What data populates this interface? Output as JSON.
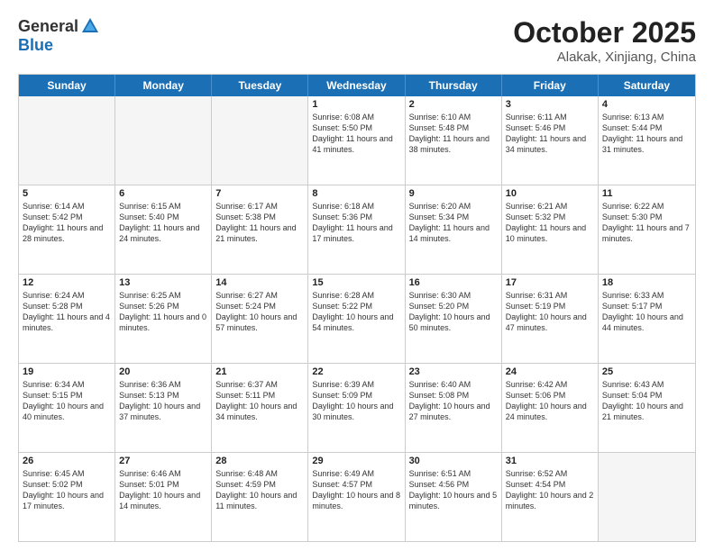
{
  "logo": {
    "general": "General",
    "blue": "Blue"
  },
  "title": "October 2025",
  "location": "Alakak, Xinjiang, China",
  "header_days": [
    "Sunday",
    "Monday",
    "Tuesday",
    "Wednesday",
    "Thursday",
    "Friday",
    "Saturday"
  ],
  "weeks": [
    [
      {
        "day": "",
        "text": "",
        "empty": true
      },
      {
        "day": "",
        "text": "",
        "empty": true
      },
      {
        "day": "",
        "text": "",
        "empty": true
      },
      {
        "day": "1",
        "text": "Sunrise: 6:08 AM\nSunset: 5:50 PM\nDaylight: 11 hours and 41 minutes."
      },
      {
        "day": "2",
        "text": "Sunrise: 6:10 AM\nSunset: 5:48 PM\nDaylight: 11 hours and 38 minutes."
      },
      {
        "day": "3",
        "text": "Sunrise: 6:11 AM\nSunset: 5:46 PM\nDaylight: 11 hours and 34 minutes."
      },
      {
        "day": "4",
        "text": "Sunrise: 6:13 AM\nSunset: 5:44 PM\nDaylight: 11 hours and 31 minutes."
      }
    ],
    [
      {
        "day": "5",
        "text": "Sunrise: 6:14 AM\nSunset: 5:42 PM\nDaylight: 11 hours and 28 minutes."
      },
      {
        "day": "6",
        "text": "Sunrise: 6:15 AM\nSunset: 5:40 PM\nDaylight: 11 hours and 24 minutes."
      },
      {
        "day": "7",
        "text": "Sunrise: 6:17 AM\nSunset: 5:38 PM\nDaylight: 11 hours and 21 minutes."
      },
      {
        "day": "8",
        "text": "Sunrise: 6:18 AM\nSunset: 5:36 PM\nDaylight: 11 hours and 17 minutes."
      },
      {
        "day": "9",
        "text": "Sunrise: 6:20 AM\nSunset: 5:34 PM\nDaylight: 11 hours and 14 minutes."
      },
      {
        "day": "10",
        "text": "Sunrise: 6:21 AM\nSunset: 5:32 PM\nDaylight: 11 hours and 10 minutes."
      },
      {
        "day": "11",
        "text": "Sunrise: 6:22 AM\nSunset: 5:30 PM\nDaylight: 11 hours and 7 minutes."
      }
    ],
    [
      {
        "day": "12",
        "text": "Sunrise: 6:24 AM\nSunset: 5:28 PM\nDaylight: 11 hours and 4 minutes."
      },
      {
        "day": "13",
        "text": "Sunrise: 6:25 AM\nSunset: 5:26 PM\nDaylight: 11 hours and 0 minutes."
      },
      {
        "day": "14",
        "text": "Sunrise: 6:27 AM\nSunset: 5:24 PM\nDaylight: 10 hours and 57 minutes."
      },
      {
        "day": "15",
        "text": "Sunrise: 6:28 AM\nSunset: 5:22 PM\nDaylight: 10 hours and 54 minutes."
      },
      {
        "day": "16",
        "text": "Sunrise: 6:30 AM\nSunset: 5:20 PM\nDaylight: 10 hours and 50 minutes."
      },
      {
        "day": "17",
        "text": "Sunrise: 6:31 AM\nSunset: 5:19 PM\nDaylight: 10 hours and 47 minutes."
      },
      {
        "day": "18",
        "text": "Sunrise: 6:33 AM\nSunset: 5:17 PM\nDaylight: 10 hours and 44 minutes."
      }
    ],
    [
      {
        "day": "19",
        "text": "Sunrise: 6:34 AM\nSunset: 5:15 PM\nDaylight: 10 hours and 40 minutes."
      },
      {
        "day": "20",
        "text": "Sunrise: 6:36 AM\nSunset: 5:13 PM\nDaylight: 10 hours and 37 minutes."
      },
      {
        "day": "21",
        "text": "Sunrise: 6:37 AM\nSunset: 5:11 PM\nDaylight: 10 hours and 34 minutes."
      },
      {
        "day": "22",
        "text": "Sunrise: 6:39 AM\nSunset: 5:09 PM\nDaylight: 10 hours and 30 minutes."
      },
      {
        "day": "23",
        "text": "Sunrise: 6:40 AM\nSunset: 5:08 PM\nDaylight: 10 hours and 27 minutes."
      },
      {
        "day": "24",
        "text": "Sunrise: 6:42 AM\nSunset: 5:06 PM\nDaylight: 10 hours and 24 minutes."
      },
      {
        "day": "25",
        "text": "Sunrise: 6:43 AM\nSunset: 5:04 PM\nDaylight: 10 hours and 21 minutes."
      }
    ],
    [
      {
        "day": "26",
        "text": "Sunrise: 6:45 AM\nSunset: 5:02 PM\nDaylight: 10 hours and 17 minutes."
      },
      {
        "day": "27",
        "text": "Sunrise: 6:46 AM\nSunset: 5:01 PM\nDaylight: 10 hours and 14 minutes."
      },
      {
        "day": "28",
        "text": "Sunrise: 6:48 AM\nSunset: 4:59 PM\nDaylight: 10 hours and 11 minutes."
      },
      {
        "day": "29",
        "text": "Sunrise: 6:49 AM\nSunset: 4:57 PM\nDaylight: 10 hours and 8 minutes."
      },
      {
        "day": "30",
        "text": "Sunrise: 6:51 AM\nSunset: 4:56 PM\nDaylight: 10 hours and 5 minutes."
      },
      {
        "day": "31",
        "text": "Sunrise: 6:52 AM\nSunset: 4:54 PM\nDaylight: 10 hours and 2 minutes."
      },
      {
        "day": "",
        "text": "",
        "empty": true
      }
    ]
  ]
}
